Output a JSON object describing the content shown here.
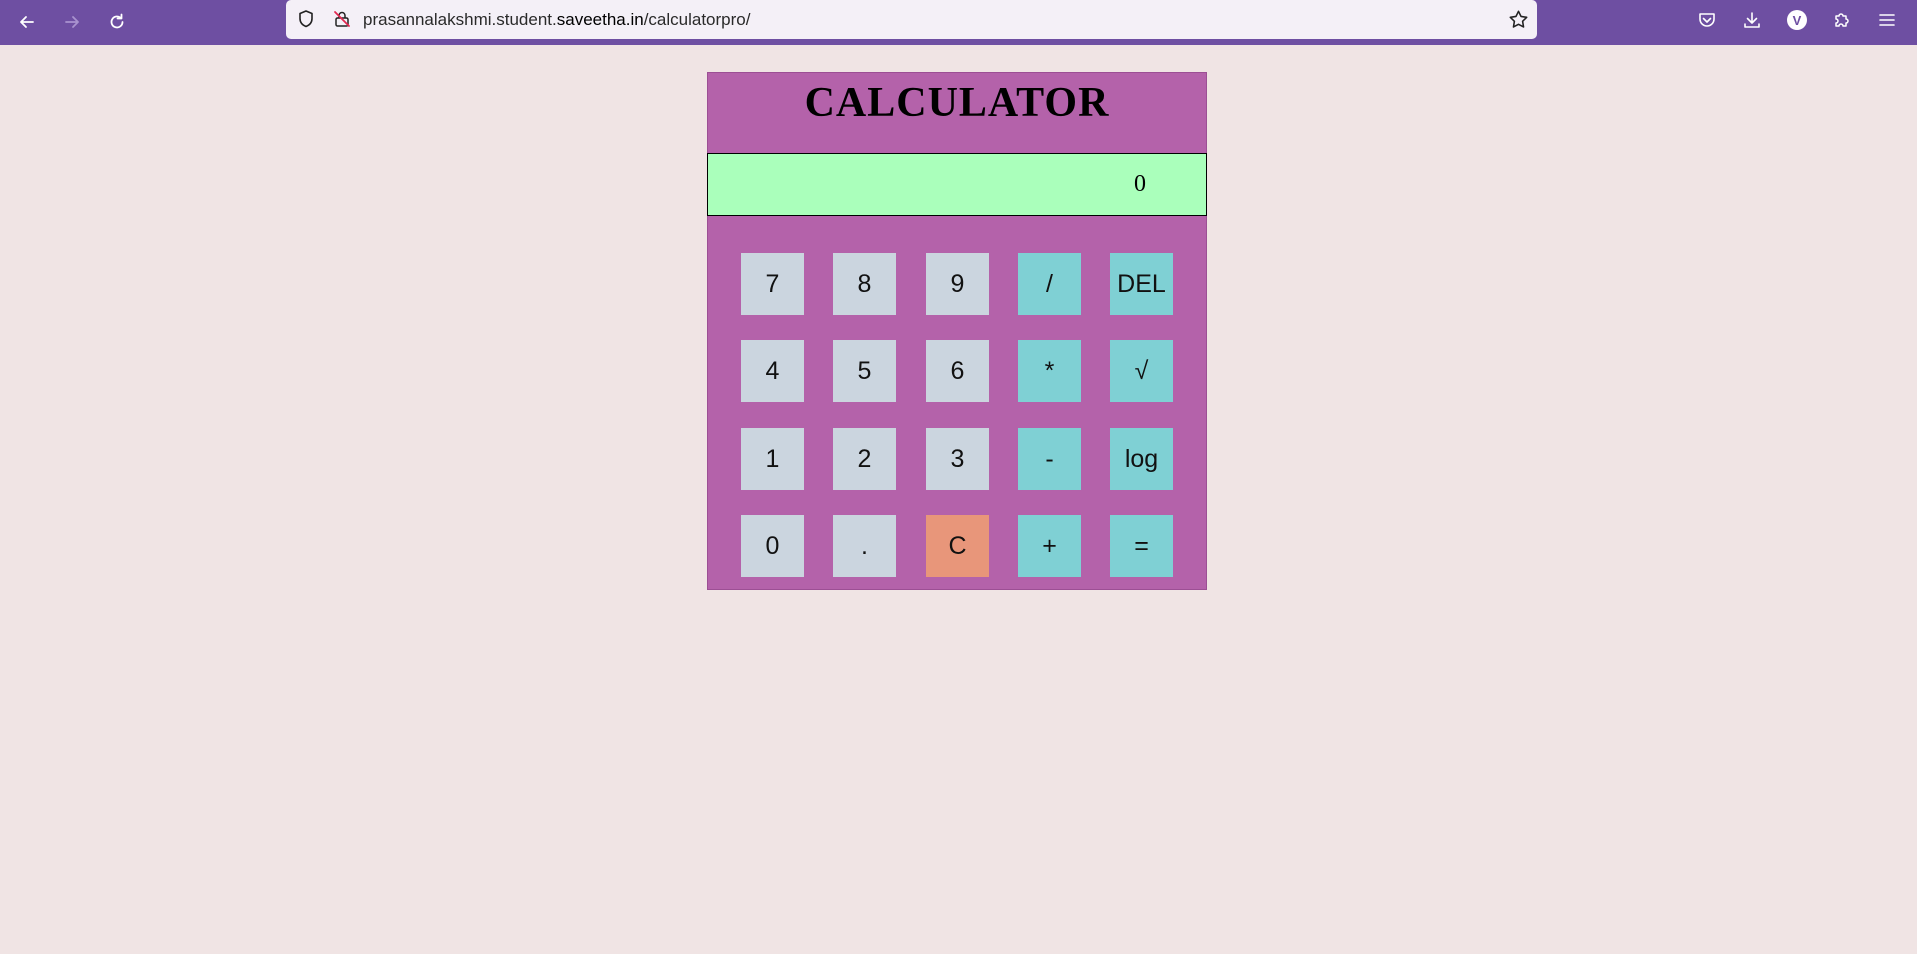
{
  "browser": {
    "url_prefix": "prasannalakshmi.student.",
    "url_domain": "saveetha.in",
    "url_path": "/calculatorpro/",
    "profile_initial": "V",
    "accent_color": "#6e4fa2"
  },
  "calculator": {
    "title": "CALCULATOR",
    "display_value": "0",
    "rows": [
      [
        {
          "label": "7",
          "kind": "num"
        },
        {
          "label": "8",
          "kind": "num"
        },
        {
          "label": "9",
          "kind": "num"
        },
        {
          "label": "/",
          "kind": "op"
        },
        {
          "label": "DEL",
          "kind": "op"
        }
      ],
      [
        {
          "label": "4",
          "kind": "num"
        },
        {
          "label": "5",
          "kind": "num"
        },
        {
          "label": "6",
          "kind": "num"
        },
        {
          "label": "*",
          "kind": "op"
        },
        {
          "label": "√",
          "kind": "op"
        }
      ],
      [
        {
          "label": "1",
          "kind": "num"
        },
        {
          "label": "2",
          "kind": "num"
        },
        {
          "label": "3",
          "kind": "num"
        },
        {
          "label": "-",
          "kind": "op"
        },
        {
          "label": "log",
          "kind": "op"
        }
      ],
      [
        {
          "label": "0",
          "kind": "num"
        },
        {
          "label": ".",
          "kind": "num"
        },
        {
          "label": "C",
          "kind": "clear"
        },
        {
          "label": "+",
          "kind": "op"
        },
        {
          "label": "=",
          "kind": "op"
        }
      ]
    ],
    "colors": {
      "body": "#b462aa",
      "display": "#aaffbb",
      "number_key": "#cbd5df",
      "operator_key": "#7fd0d4",
      "clear_key": "#e8967a"
    }
  }
}
